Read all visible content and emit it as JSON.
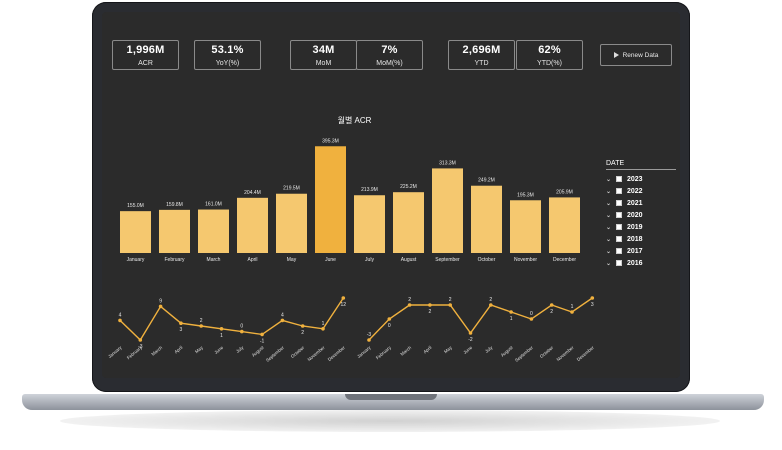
{
  "kpis": [
    {
      "value": "1,996M",
      "label": "ACR"
    },
    {
      "value": "53.1%",
      "label": "YoY(%)"
    },
    {
      "value": "34M",
      "label": "MoM"
    },
    {
      "value": "7%",
      "label": "MoM(%)"
    },
    {
      "value": "2,696M",
      "label": "YTD"
    },
    {
      "value": "62%",
      "label": "YTD(%)"
    }
  ],
  "renew_button": {
    "label": "Renew Data",
    "icon": "play-icon"
  },
  "date_filter": {
    "title": "DATE",
    "years": [
      "2023",
      "2022",
      "2021",
      "2020",
      "2019",
      "2018",
      "2017",
      "2016"
    ]
  },
  "colors": {
    "screen_bg": "#2b2b2b",
    "bar": "#f5c86f",
    "bar_highlight": "#f0b13e",
    "line": "#f0b13e"
  },
  "chart_data": [
    {
      "type": "bar",
      "title": "월별 ACR",
      "categories": [
        "January",
        "February",
        "March",
        "April",
        "May",
        "June",
        "July",
        "August",
        "September",
        "October",
        "November",
        "December"
      ],
      "values": [
        155.0,
        159.8,
        161.0,
        204.4,
        219.5,
        395.3,
        213.9,
        225.2,
        313.3,
        249.2,
        195.3,
        205.9
      ],
      "data_labels": [
        "155.0M",
        "159.8M",
        "161.0M",
        "204.4M",
        "219.5M",
        "395.3M",
        "213.9M",
        "225.2M",
        "313.3M",
        "249.2M",
        "195.3M",
        "205.9M"
      ]
    },
    {
      "type": "line",
      "categories": [
        "January",
        "February",
        "March",
        "April",
        "May",
        "June",
        "July",
        "August",
        "September",
        "October",
        "November",
        "December"
      ],
      "values": [
        4,
        -3,
        9,
        3,
        2,
        1,
        0,
        -1,
        4,
        2,
        1,
        12
      ]
    },
    {
      "type": "line",
      "categories": [
        "January",
        "February",
        "March",
        "April",
        "May",
        "June",
        "July",
        "August",
        "September",
        "October",
        "November",
        "December"
      ],
      "values": [
        -3,
        0,
        2,
        2,
        2,
        -2,
        2,
        1,
        0,
        2,
        1,
        3
      ]
    }
  ]
}
